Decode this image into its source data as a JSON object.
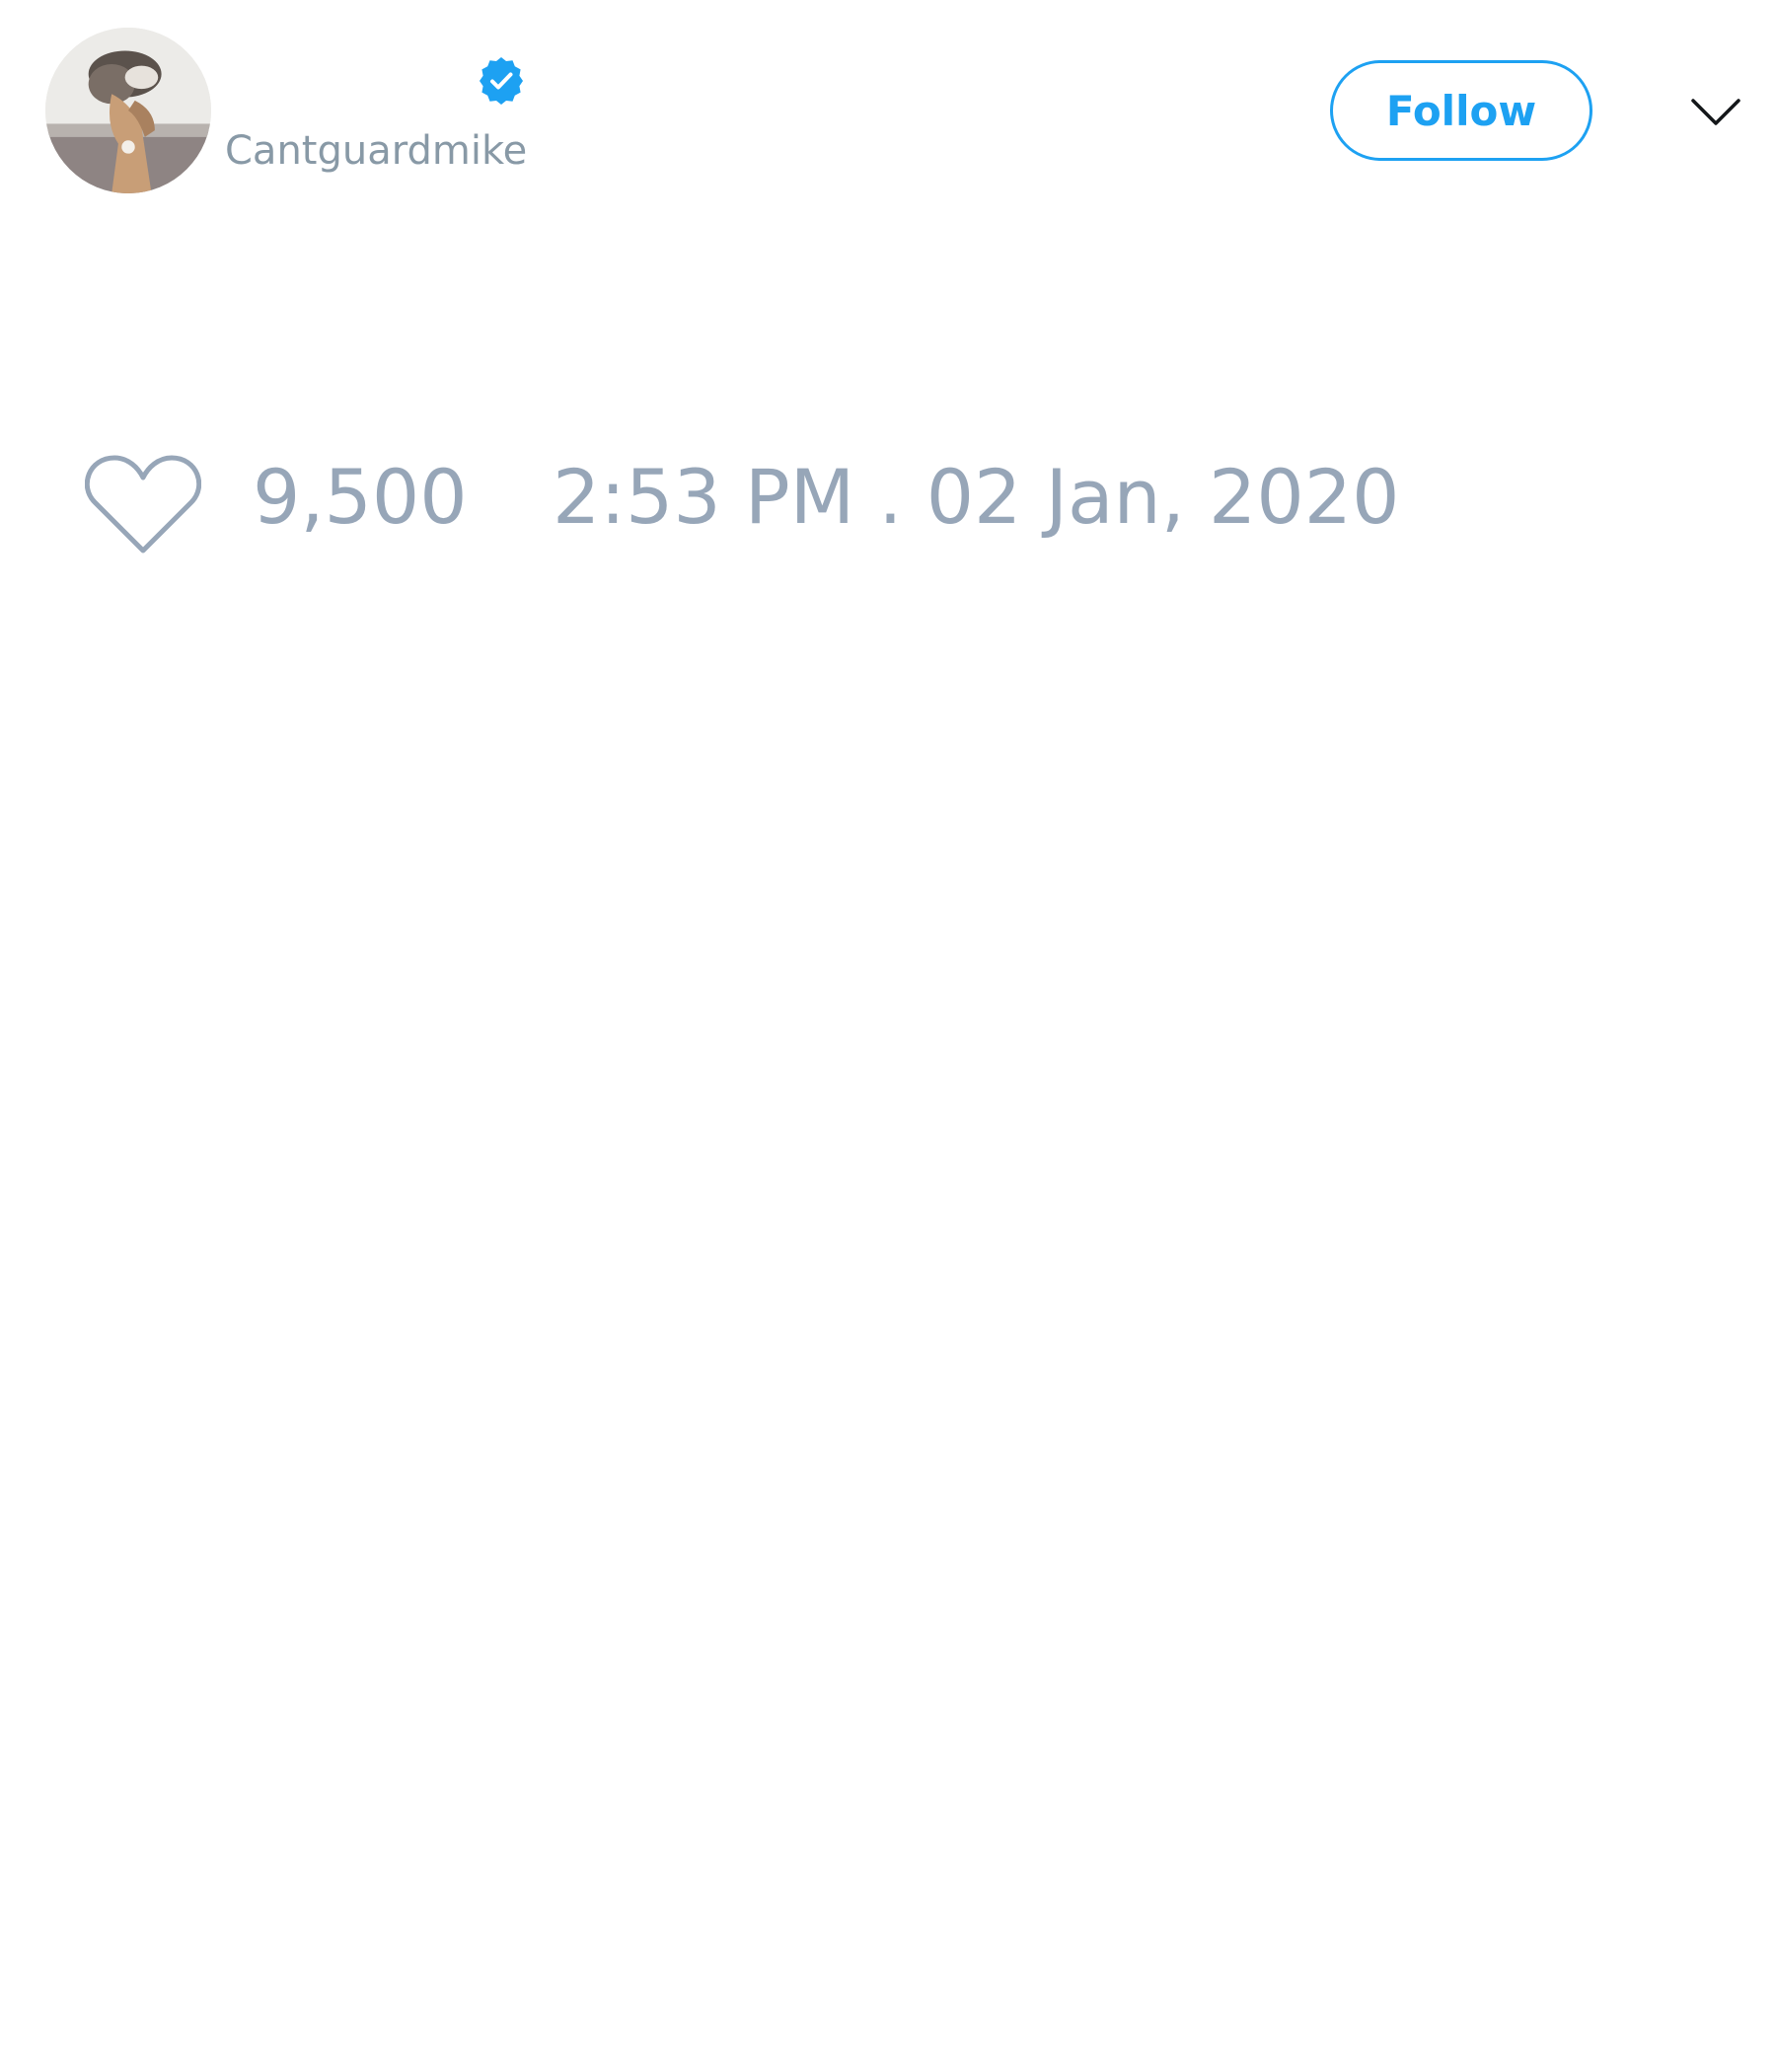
{
  "tweet": {
    "author": {
      "display_name": "",
      "handle": "Cantguardmike",
      "verified": true,
      "avatar_icon": "avatar-photo"
    },
    "follow_label": "Follow",
    "menu_icon": "chevron-down-icon",
    "likes": {
      "icon": "heart-icon",
      "count": "9,500"
    },
    "timestamp": "2:53 PM . 02 Jan, 2020"
  },
  "colors": {
    "accent": "#1da1f2",
    "muted_text": "#8899a6",
    "meta_text": "#97a6b8",
    "background": "#ffffff"
  }
}
